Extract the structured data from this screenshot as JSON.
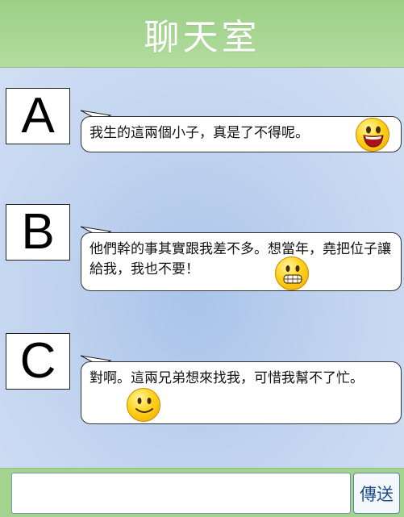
{
  "header": {
    "title": "聊天室"
  },
  "messages": [
    {
      "user": "A",
      "text": "我生的這兩個小子，真是了不得呢。",
      "emoji": "laughing-smiley"
    },
    {
      "user": "B",
      "text": "他們幹的事其實跟我差不多。想當年，堯把位子讓給我，我也不要！",
      "emoji": "grinning-smiley"
    },
    {
      "user": "C",
      "text": "對啊。這兩兄弟想來找我，可惜我幫不了忙。",
      "emoji": "smiling-smiley"
    }
  ],
  "composer": {
    "input_value": "",
    "send_label": "傳送"
  }
}
